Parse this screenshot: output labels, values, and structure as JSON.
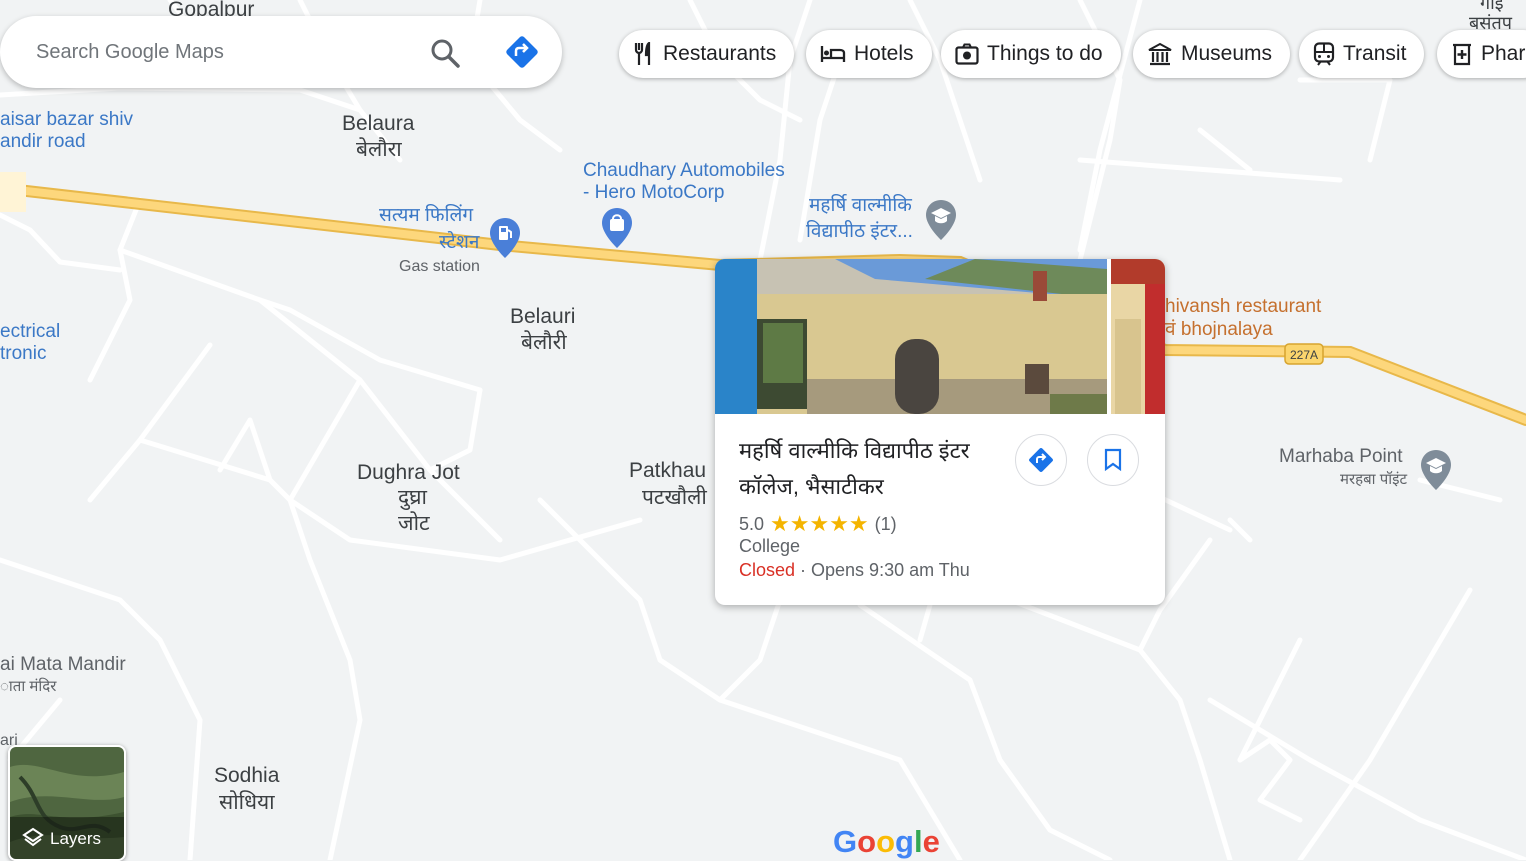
{
  "search": {
    "placeholder": "Search Google Maps",
    "search_icon": "search-icon",
    "directions_icon": "directions-icon"
  },
  "categories": [
    {
      "label": "Restaurants",
      "icon": "fork-knife-icon"
    },
    {
      "label": "Hotels",
      "icon": "bed-icon"
    },
    {
      "label": "Things to do",
      "icon": "camera-icon"
    },
    {
      "label": "Museums",
      "icon": "museum-icon"
    },
    {
      "label": "Transit",
      "icon": "train-icon"
    },
    {
      "label": "Phar",
      "icon": "pharmacy-icon"
    }
  ],
  "map": {
    "places": {
      "gopalpur": "Gopalpur",
      "belaura_en": "Belaura",
      "belaura_hi": "बेलौरा",
      "belauri_en": "Belauri",
      "belauri_hi": "बेलौरी",
      "dughra_en": "Dughra Jot",
      "dughra_hi1": "दुघ्रा",
      "dughra_hi2": "जोट",
      "patkhau_en": "Patkhau",
      "patkhau_hi": "पटखौली",
      "sodhia_en": "Sodhia",
      "sodhia_hi": "सोधिया",
      "top_right_1": "गाई",
      "top_right_2": "बसंतप"
    },
    "pois": {
      "kaisar_1": "aisar bazar shiv",
      "kaisar_2": "andir road",
      "satyam_1": "सत्यम फिलिंग",
      "satyam_2": "स्टेशन",
      "satyam_cat": "Gas station",
      "chaudhary_1": "Chaudhary Automobiles",
      "chaudhary_2": "- Hero MotoCorp",
      "maharshi_1": "महर्षि वाल्मीकि",
      "maharshi_2": "विद्यापीठ इंटर...",
      "electrical_1": "ectrical",
      "electrical_2": "tronic",
      "shivansh_1": "hivansh restaurant",
      "shivansh_2": "वं bhojnalaya",
      "marhaba_en": "Marhaba Point",
      "marhaba_hi": "मरहबा पॉइंट",
      "mata_en": "ai Mata Mandir",
      "mata_hi": "ाता मंदिर",
      "ari": "ari"
    },
    "road_shield": "227A"
  },
  "place_card": {
    "title": "महर्षि वाल्मीकि विद्यापीठ इंटर कॉलेज, भैसाटीकर",
    "rating": "5.0",
    "stars": "★★★★★",
    "review_count": "(1)",
    "category": "College",
    "status": "Closed",
    "hours": " · Opens 9:30 am Thu"
  },
  "layers": {
    "label": "Layers"
  },
  "logo": "Google",
  "colors": {
    "accent_blue": "#1a73e8",
    "highway": "#f9d26b",
    "closed_red": "#d93025",
    "star": "#f4b400"
  }
}
